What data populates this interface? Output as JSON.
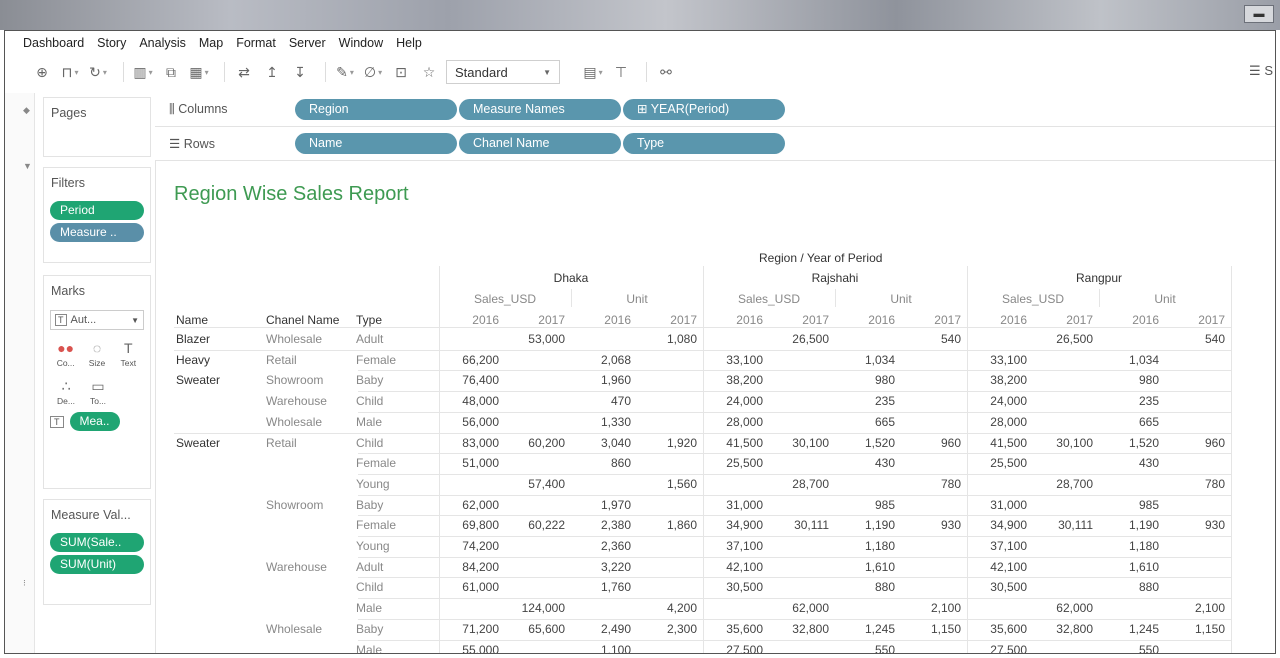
{
  "window": {
    "control_label": "▬"
  },
  "menu": [
    "Dashboard",
    "Story",
    "Analysis",
    "Map",
    "Format",
    "Server",
    "Window",
    "Help"
  ],
  "toolbar": {
    "fit_select": "Standard",
    "right_label": "S"
  },
  "pages": {
    "title": "Pages"
  },
  "filters": {
    "title": "Filters",
    "pills": [
      "Period",
      "Measure .."
    ]
  },
  "marks": {
    "title": "Marks",
    "type_select": "Aut...",
    "controls": [
      {
        "name": "color",
        "label": "Co...",
        "icon": "●●"
      },
      {
        "name": "size",
        "label": "Size",
        "icon": "◌"
      },
      {
        "name": "text",
        "label": "Text",
        "icon": "T"
      },
      {
        "name": "detail",
        "label": "De...",
        "icon": "∴"
      },
      {
        "name": "tooltip",
        "label": "To...",
        "icon": "▭"
      }
    ],
    "text_pill": "Mea.."
  },
  "measure_values": {
    "title": "Measure Val...",
    "pills": [
      "SUM(Sale..",
      "SUM(Unit)"
    ]
  },
  "shelves": {
    "columns_label": "Columns",
    "columns": [
      "Region",
      "Measure Names",
      "⊞ YEAR(Period)"
    ],
    "rows_label": "Rows",
    "rows": [
      "Name",
      "Chanel Name",
      "Type"
    ]
  },
  "report": {
    "title": "Region Wise Sales Report",
    "header_top": "Region / Year of Period",
    "row_headers": [
      "Name",
      "Chanel Name",
      "Type"
    ],
    "regions": [
      "Dhaka",
      "Rajshahi",
      "Rangpur"
    ],
    "measures": [
      "Sales_USD",
      "Unit"
    ],
    "years": [
      "2016",
      "2017"
    ],
    "names": [
      {
        "label": "Blazer",
        "row": 0
      },
      {
        "label": "Heavy",
        "row": 1
      },
      {
        "label": "Sweater",
        "row": 2
      },
      {
        "label": "Sweater",
        "row": 5
      }
    ],
    "channels": [
      {
        "label": "Wholesale",
        "row": 0
      },
      {
        "label": "Retail",
        "row": 1
      },
      {
        "label": "Showroom",
        "row": 2
      },
      {
        "label": "Warehouse",
        "row": 3
      },
      {
        "label": "Wholesale",
        "row": 4
      },
      {
        "label": "Retail",
        "row": 5
      },
      {
        "label": "Showroom",
        "row": 8
      },
      {
        "label": "Warehouse",
        "row": 11
      },
      {
        "label": "Wholesale",
        "row": 14
      }
    ],
    "rows": [
      {
        "type": "Adult",
        "values": [
          "",
          "53,000",
          "",
          "1,080",
          "",
          "26,500",
          "",
          "540",
          "",
          "26,500",
          "",
          "540"
        ]
      },
      {
        "type": "Female",
        "values": [
          "66,200",
          "",
          "2,068",
          "",
          "33,100",
          "",
          "1,034",
          "",
          "33,100",
          "",
          "1,034",
          ""
        ]
      },
      {
        "type": "Baby",
        "values": [
          "76,400",
          "",
          "1,960",
          "",
          "38,200",
          "",
          "980",
          "",
          "38,200",
          "",
          "980",
          ""
        ]
      },
      {
        "type": "Child",
        "values": [
          "48,000",
          "",
          "470",
          "",
          "24,000",
          "",
          "235",
          "",
          "24,000",
          "",
          "235",
          ""
        ]
      },
      {
        "type": "Male",
        "values": [
          "56,000",
          "",
          "1,330",
          "",
          "28,000",
          "",
          "665",
          "",
          "28,000",
          "",
          "665",
          ""
        ]
      },
      {
        "type": "Child",
        "values": [
          "83,000",
          "60,200",
          "3,040",
          "1,920",
          "41,500",
          "30,100",
          "1,520",
          "960",
          "41,500",
          "30,100",
          "1,520",
          "960"
        ]
      },
      {
        "type": "Female",
        "values": [
          "51,000",
          "",
          "860",
          "",
          "25,500",
          "",
          "430",
          "",
          "25,500",
          "",
          "430",
          ""
        ]
      },
      {
        "type": "Young",
        "values": [
          "",
          "57,400",
          "",
          "1,560",
          "",
          "28,700",
          "",
          "780",
          "",
          "28,700",
          "",
          "780"
        ]
      },
      {
        "type": "Baby",
        "values": [
          "62,000",
          "",
          "1,970",
          "",
          "31,000",
          "",
          "985",
          "",
          "31,000",
          "",
          "985",
          ""
        ]
      },
      {
        "type": "Female",
        "values": [
          "69,800",
          "60,222",
          "2,380",
          "1,860",
          "34,900",
          "30,111",
          "1,190",
          "930",
          "34,900",
          "30,111",
          "1,190",
          "930"
        ]
      },
      {
        "type": "Young",
        "values": [
          "74,200",
          "",
          "2,360",
          "",
          "37,100",
          "",
          "1,180",
          "",
          "37,100",
          "",
          "1,180",
          ""
        ]
      },
      {
        "type": "Adult",
        "values": [
          "84,200",
          "",
          "3,220",
          "",
          "42,100",
          "",
          "1,610",
          "",
          "42,100",
          "",
          "1,610",
          ""
        ]
      },
      {
        "type": "Child",
        "values": [
          "61,000",
          "",
          "1,760",
          "",
          "30,500",
          "",
          "880",
          "",
          "30,500",
          "",
          "880",
          ""
        ]
      },
      {
        "type": "Male",
        "values": [
          "",
          "124,000",
          "",
          "4,200",
          "",
          "62,000",
          "",
          "2,100",
          "",
          "62,000",
          "",
          "2,100"
        ]
      },
      {
        "type": "Baby",
        "values": [
          "71,200",
          "65,600",
          "2,490",
          "2,300",
          "35,600",
          "32,800",
          "1,245",
          "1,150",
          "35,600",
          "32,800",
          "1,245",
          "1,150"
        ]
      },
      {
        "type": "Male",
        "values": [
          "55,000",
          "",
          "1,100",
          "",
          "27,500",
          "",
          "550",
          "",
          "27,500",
          "",
          "550",
          ""
        ]
      }
    ]
  }
}
